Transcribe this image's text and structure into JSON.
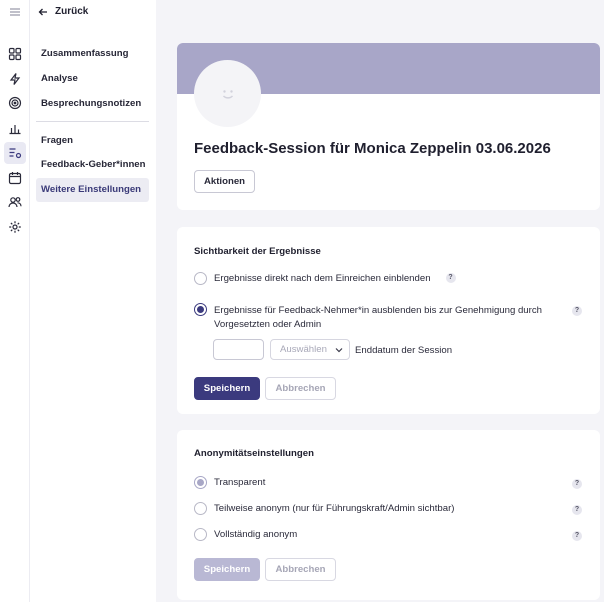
{
  "rail": {
    "icons": [
      "menu-icon",
      "dashboard-grid-icon",
      "lightning-icon",
      "target-icon",
      "chart-bars-icon",
      "list-settings-icon",
      "calendar-icon",
      "people-icon",
      "gear-icon"
    ]
  },
  "nav": {
    "back_label": "Zurück",
    "group1": [
      "Zusammenfassung",
      "Analyse",
      "Besprechungsnotizen"
    ],
    "group2": [
      "Fragen",
      "Feedback-Geber*innen",
      "Weitere Einstellungen"
    ],
    "active": "Weitere Einstellungen"
  },
  "header": {
    "title": "Feedback-Session für Monica Zeppelin 03.06.2026",
    "actions_label": "Aktionen"
  },
  "visibility": {
    "title": "Sichtbarkeit der Ergebnisse",
    "option1": "Ergebnisse direkt nach dem Einreichen einblenden",
    "option2_line1": "Ergebnisse für Feedback-Nehmer*in ausblenden bis zur Genehmigung durch",
    "option2_line2": "Vorgesetzten oder Admin",
    "date_value": "",
    "select_placeholder": "Auswählen",
    "date_label": "Enddatum der Session",
    "save_label": "Speichern",
    "cancel_label": "Abbrechen"
  },
  "anonymity": {
    "title": "Anonymitätseinstellungen",
    "option1": "Transparent",
    "option2": "Teilweise anonym (nur für Führungskraft/Admin sichtbar)",
    "option3": "Vollständig anonym",
    "save_label": "Speichern",
    "cancel_label": "Abbrechen"
  },
  "help_glyph": "?",
  "colors": {
    "accent": "#3b3a7e",
    "banner": "#a8a6c8",
    "background": "#f4f4f8"
  }
}
